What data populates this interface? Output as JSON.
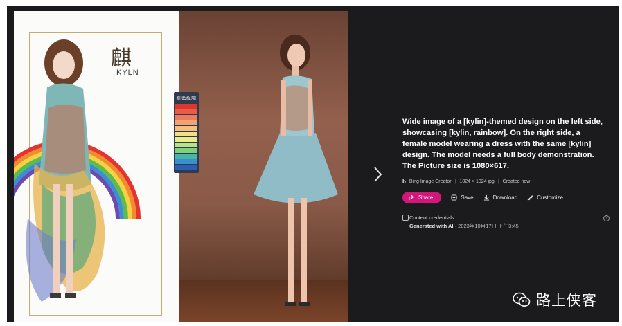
{
  "image": {
    "left_title": "麒",
    "left_subtitle": "KYLN",
    "swatch_title": "紅藍綠調",
    "swatch_colors": [
      "#e0352f",
      "#ea5c4a",
      "#ee7b5b",
      "#f3a273",
      "#f6c07c",
      "#f4dd88",
      "#e9ec8a",
      "#b9e283",
      "#7fcf7b",
      "#47b7a4",
      "#3b8fd0",
      "#2b5fb5"
    ]
  },
  "nav": {
    "next_icon": "chevron-right-icon"
  },
  "details": {
    "prompt": "Wide image of a [kylin]-themed design on the left side, showcasing [kylin, rainbow]. On the right side, a female model wearing a dress with the same [kylin] design. The model needs a full body demonstration. The Picture size is 1080×617.",
    "creator": "Bing Image Creator",
    "size": "1024 × 1024 jpg",
    "created": "Created now",
    "sep": "|"
  },
  "actions": {
    "share": "Share",
    "save": "Save",
    "download": "Download",
    "customize": "Customize"
  },
  "credentials": {
    "title": "Content credentials",
    "generated_label": "Generated with AI",
    "generated_sep": "·",
    "timestamp": "2023年10月17日 下午3:45",
    "help": "?"
  },
  "watermark": {
    "text": "路上侠客"
  }
}
